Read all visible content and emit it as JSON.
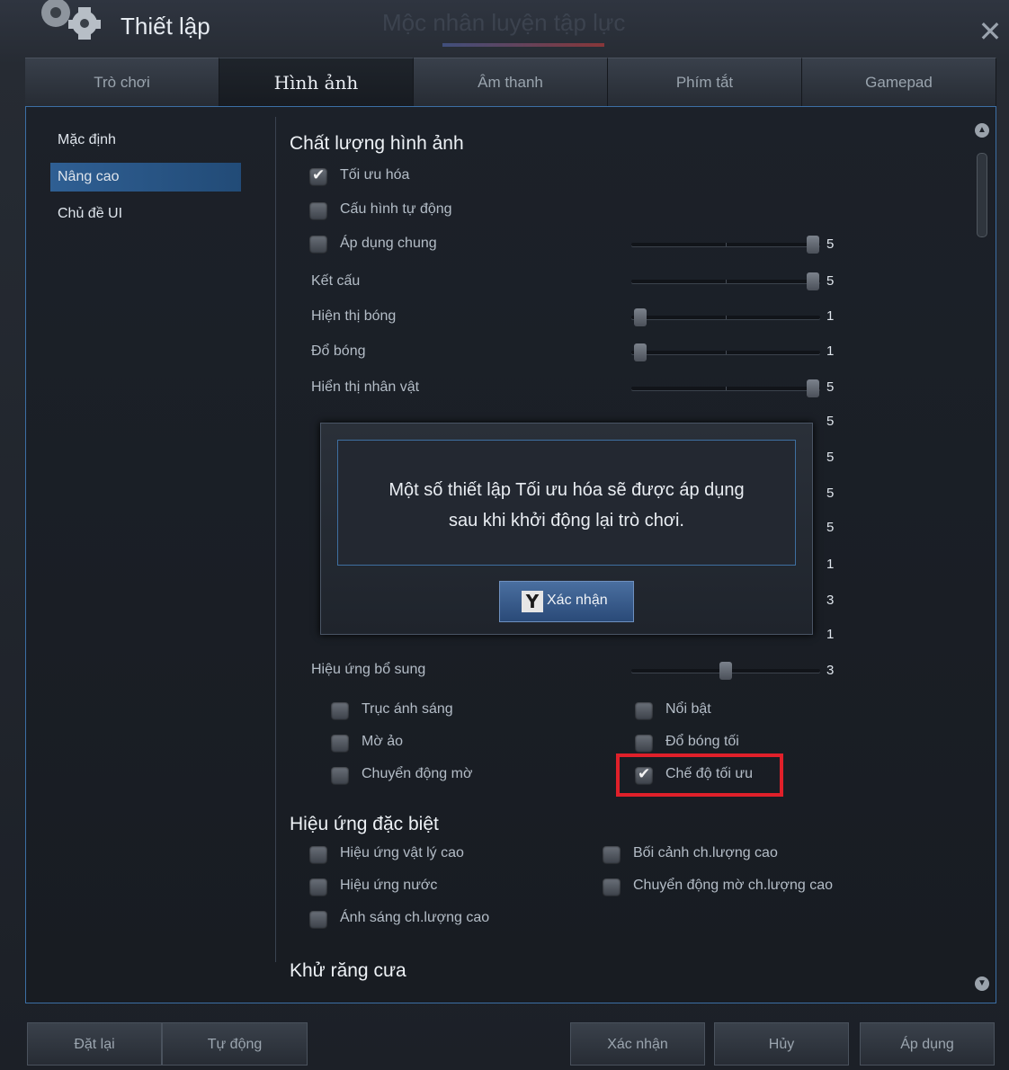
{
  "window": {
    "title": "Thiết lập",
    "background_title": "Mộc nhân luyện tập lực",
    "close_label": "✕"
  },
  "tabs": [
    {
      "label": "Trò chơi",
      "active": false
    },
    {
      "label": "Hình ảnh",
      "active": true
    },
    {
      "label": "Âm thanh",
      "active": false
    },
    {
      "label": "Phím tắt",
      "active": false
    },
    {
      "label": "Gamepad",
      "active": false
    }
  ],
  "sidenav": [
    {
      "label": "Mặc định",
      "active": false
    },
    {
      "label": "Nâng cao",
      "active": true
    },
    {
      "label": "Chủ đề UI",
      "active": false
    }
  ],
  "image_quality": {
    "title": "Chất lượng hình ảnh",
    "optimize": {
      "label": "Tối ưu hóa",
      "checked": true
    },
    "auto_config": {
      "label": "Cấu hình tự động",
      "checked": false
    },
    "apply_general": {
      "label": "Áp dụng chung",
      "checked": false,
      "value": "5"
    },
    "sliders": [
      {
        "label": "Kết cấu",
        "value": "5"
      },
      {
        "label": "Hiện thị bóng",
        "value": "1"
      },
      {
        "label": "Đổ bóng",
        "value": "1"
      },
      {
        "label": "Hiển thị nhân vật",
        "value": "5"
      }
    ],
    "hidden_values": [
      "5",
      "5",
      "5",
      "5",
      "1",
      "3",
      "1"
    ],
    "extra_effects": {
      "label": "Hiệu ứng bổ sung",
      "value": "3"
    },
    "options": [
      {
        "label": "Trục ánh sáng",
        "checked": false
      },
      {
        "label": "Nổi bật",
        "checked": false
      },
      {
        "label": "Mờ ảo",
        "checked": false
      },
      {
        "label": "Đổ bóng tối",
        "checked": false
      },
      {
        "label": "Chuyển động mờ",
        "checked": false
      },
      {
        "label": "Chế độ tối ưu",
        "checked": true
      }
    ]
  },
  "special_effects": {
    "title": "Hiệu ứng đặc biệt",
    "options": [
      {
        "label": "Hiệu ứng vật lý cao",
        "checked": false
      },
      {
        "label": "Bối cảnh ch.lượng cao",
        "checked": false
      },
      {
        "label": "Hiệu ứng nước",
        "checked": false
      },
      {
        "label": "Chuyển động mờ ch.lượng cao",
        "checked": false
      },
      {
        "label": "Ánh sáng ch.lượng cao",
        "checked": false
      }
    ]
  },
  "antialias": {
    "title": "Khử răng cưa"
  },
  "modal": {
    "message": "Một số thiết lập Tối ưu hóa sẽ được áp dụng\nsau khi khởi động lại trò chơi.",
    "button_key": "Y",
    "button_label": "Xác nhận"
  },
  "bottom": {
    "reset": "Đặt lại",
    "auto": "Tự động",
    "confirm": "Xác nhận",
    "cancel": "Hủy",
    "apply": "Áp dụng"
  },
  "colors": {
    "accent": "#3c6fa5",
    "highlight": "#e0202a"
  }
}
